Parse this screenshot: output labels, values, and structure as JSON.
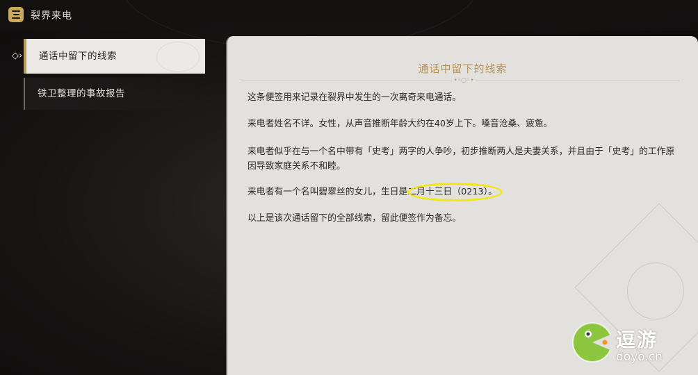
{
  "header": {
    "title": "裂界来电",
    "menu_icon": "book-menu-icon"
  },
  "sidebar": {
    "items": [
      {
        "label": "通话中留下的线索",
        "active": true
      },
      {
        "label": "铁卫整理的事故报告",
        "active": false
      }
    ],
    "pointer_icon": "diamond-arrow-icon"
  },
  "document": {
    "title": "通话中留下的线索",
    "paragraphs": [
      "这条便签用来记录在裂界中发生的一次离奇来电通话。",
      "来电者姓名不详。女性，从声音推断年龄大约在40岁上下。嗓音沧桑、疲惫。",
      "来电者似乎在与一个名中带有「史考」两字的人争吵，初步推断两人是夫妻关系，并且由于「史考」的工作原因导致家庭关系不和睦。",
      "来电者有一个名叫碧翠丝的女儿，生日是二月十三日（0213）。",
      "以上是该次通话留下的全部线索，留此便签作为备忘。"
    ]
  },
  "watermark": {
    "brand": "逗游",
    "domain": "doyo.cn"
  },
  "colors": {
    "accent_gold": "#b99256",
    "highlight": "#f1e80f",
    "panel_bg": "#e3e1de"
  }
}
